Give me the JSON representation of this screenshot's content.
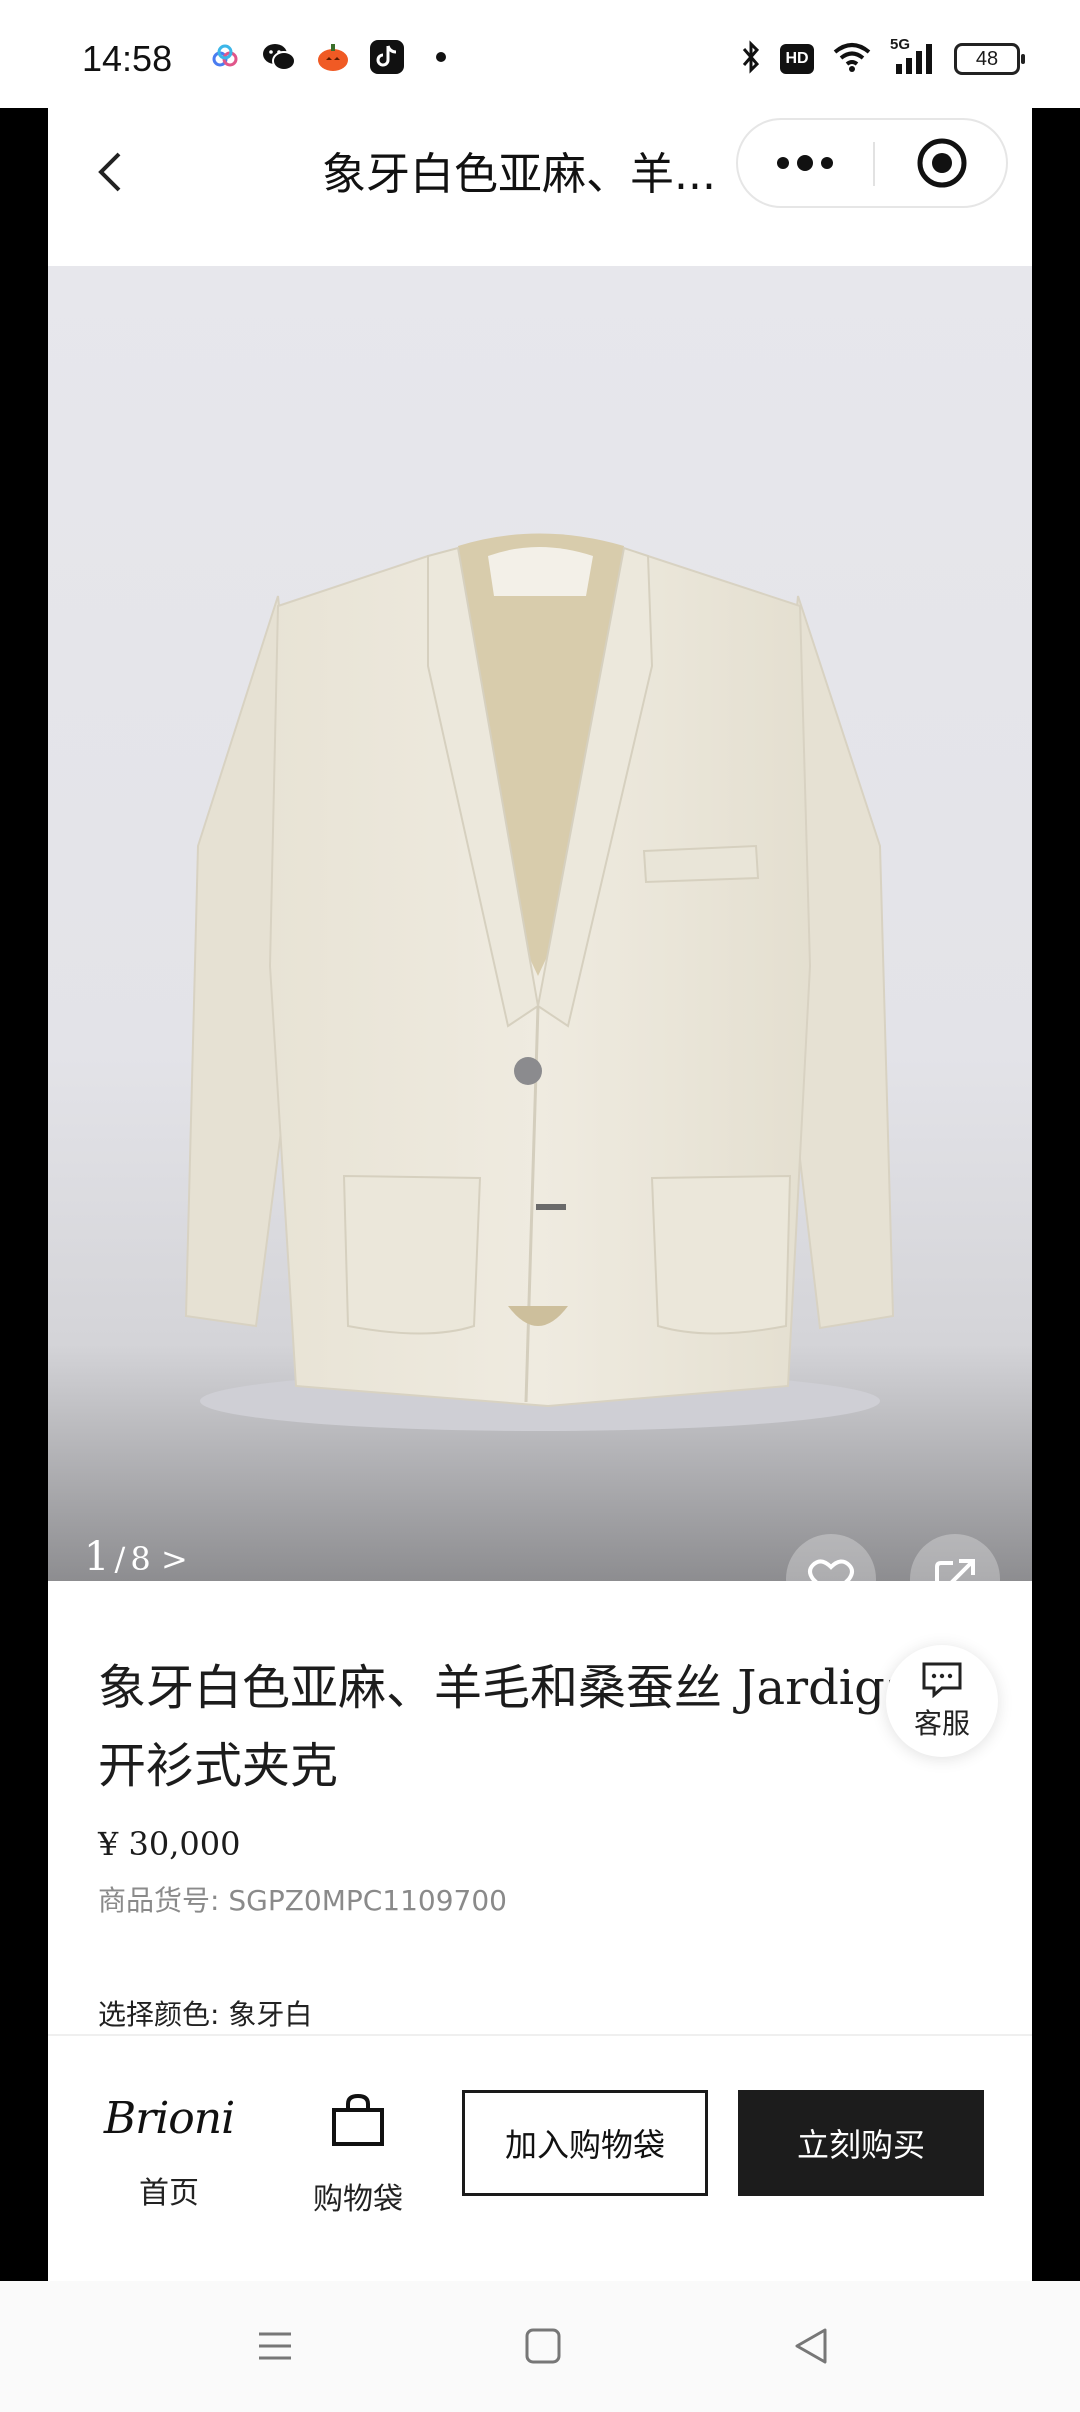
{
  "status_bar": {
    "time": "14:58",
    "network": "5G",
    "hd": "HD",
    "battery": "48",
    "app_icons": [
      "cloud-icon",
      "wechat-icon",
      "pumpkin-icon",
      "tiktok-icon",
      "dot-icon"
    ]
  },
  "header": {
    "title": "象牙白色亚麻、羊...",
    "more_icon": "more-icon",
    "close_icon": "target-icon"
  },
  "carousel": {
    "current": "1",
    "separator": "/",
    "total": "8 >",
    "progress": 0.125
  },
  "product": {
    "name": "象牙白色亚麻、羊毛和桑蚕丝 Jardiga开衫式夹克",
    "price": "¥ 30,000",
    "sku_label": "商品货号:",
    "sku_value": "SGPZ0MPC1109700",
    "color_label": "选择颜色:",
    "color_value": "象牙白"
  },
  "customer_service": {
    "label": "客服"
  },
  "action_bar": {
    "brand_logo": "Brioni",
    "home_label": "首页",
    "bag_label": "购物袋",
    "add_to_bag": "加入购物袋",
    "buy_now": "立刻购买"
  }
}
